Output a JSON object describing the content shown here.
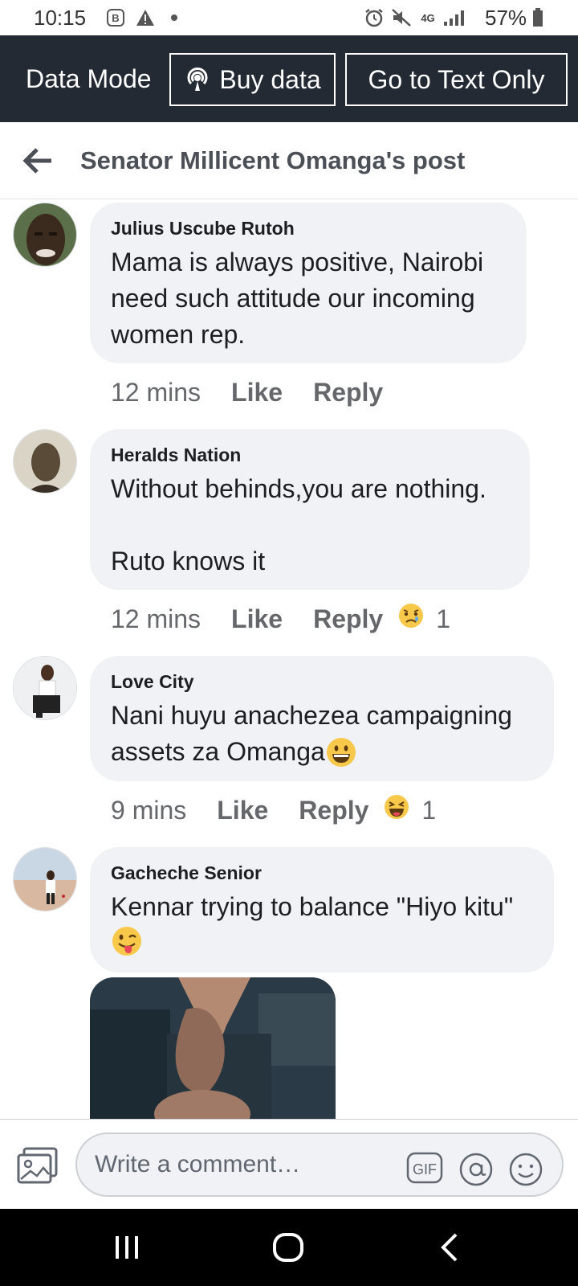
{
  "status_bar": {
    "time": "10:15",
    "network": "4G",
    "battery": "57%"
  },
  "data_bar": {
    "mode_label": "Data Mode",
    "buy_data_label": "Buy data",
    "text_only_label": "Go to Text Only"
  },
  "header": {
    "title": "Senator Millicent Omanga's post"
  },
  "comments": [
    {
      "author": "Julius Uscube Rutoh",
      "text": "Mama is always positive, Nairobi need such attitude our incoming women rep.",
      "time": "12 mins",
      "like": "Like",
      "reply": "Reply"
    },
    {
      "author": "Heralds Nation",
      "text": "Without behinds,you are nothing.\n\nRuto knows it",
      "time": "12 mins",
      "like": "Like",
      "reply": "Reply",
      "reaction": "sad-emoji",
      "reaction_count": "1"
    },
    {
      "author": "Love City",
      "text": "Nani huyu anachezea campaigning assets za Omanga",
      "time": "9 mins",
      "like": "Like",
      "reply": "Reply",
      "reaction": "haha-emoji",
      "reaction_count": "1"
    },
    {
      "author": "Gacheche Senior",
      "text": "Kennar trying to balance \"Hiyo kitu\""
    }
  ],
  "composer": {
    "placeholder": "Write a comment…",
    "gif_label": "GIF"
  },
  "colors": {
    "data_bar_bg": "#242a33",
    "bubble_bg": "#f0f2f5",
    "meta_text": "#65676b"
  }
}
